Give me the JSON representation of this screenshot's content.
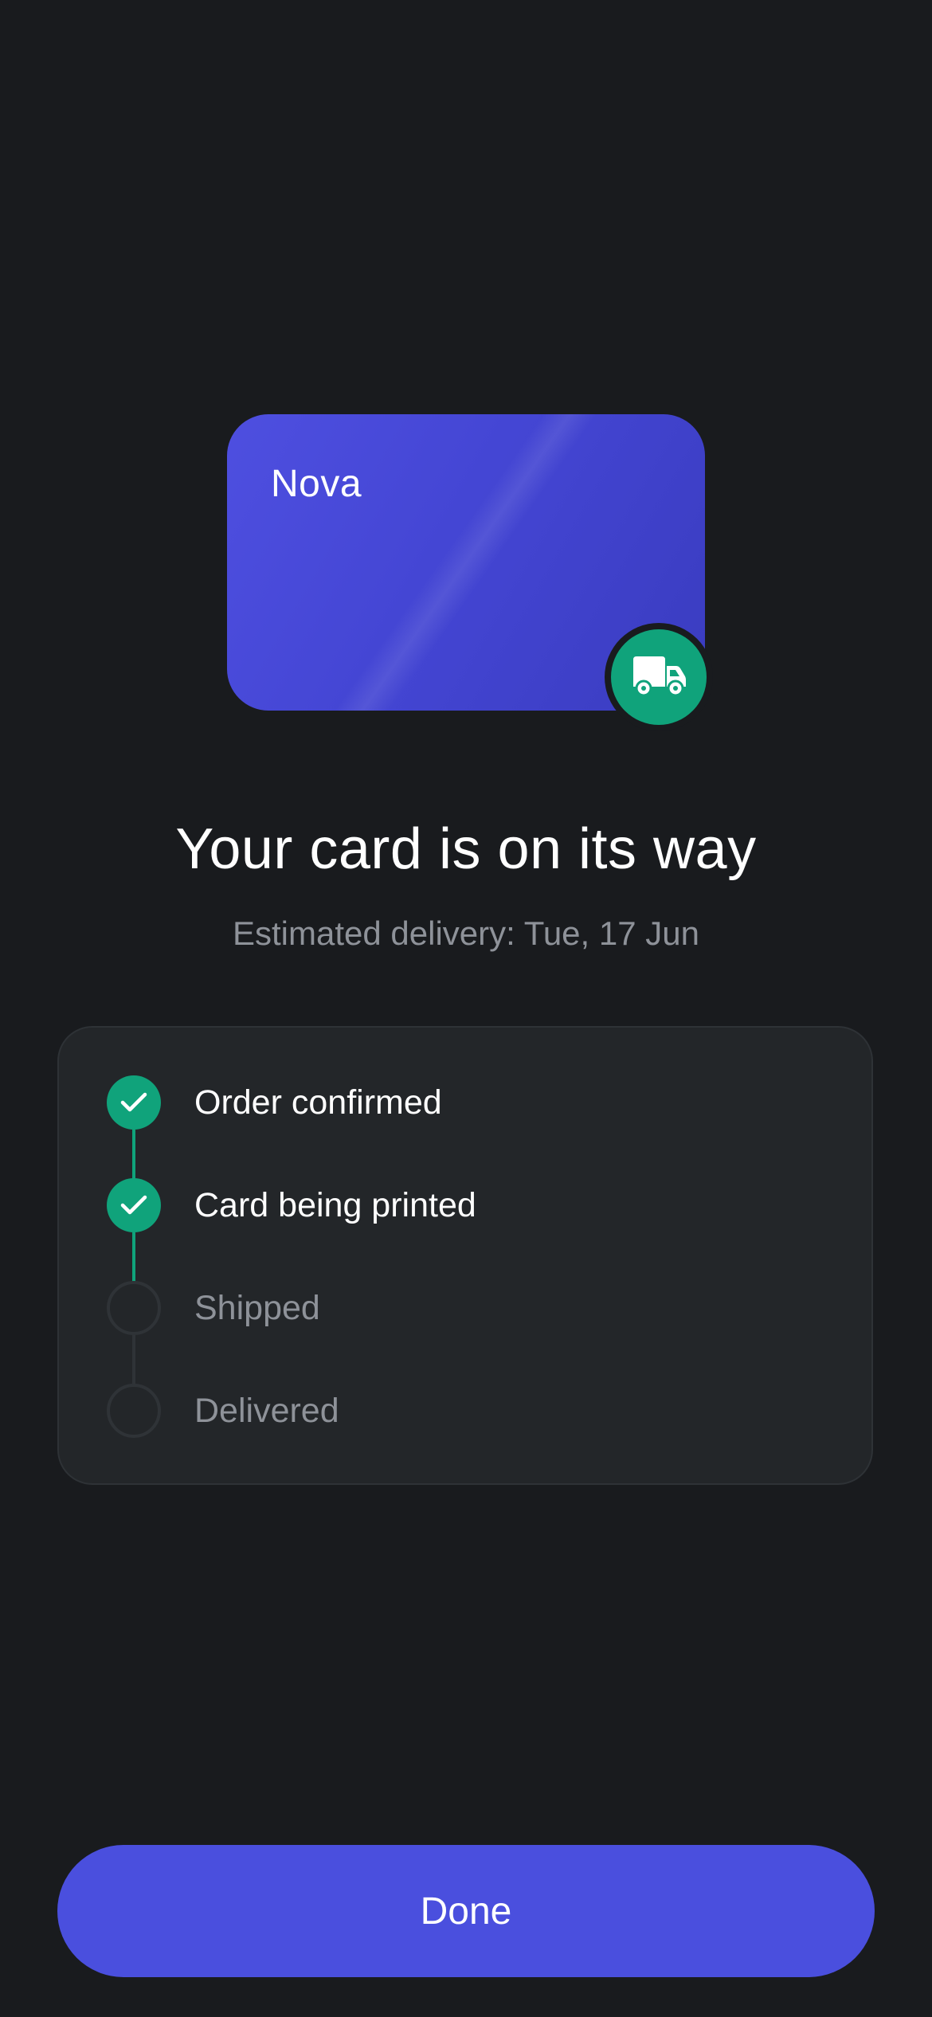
{
  "card": {
    "brand": "Nova",
    "badge_icon": "truck-icon",
    "accent_color": "#4a4fde",
    "badge_color": "#10a37b"
  },
  "header": {
    "title": "Your card is on its way",
    "subtitle": "Estimated delivery: Tue, 17 Jun"
  },
  "timeline": {
    "steps": [
      {
        "label": "Order confirmed",
        "status": "done",
        "icon": "check-icon"
      },
      {
        "label": "Card being printed",
        "status": "done",
        "icon": "check-icon"
      },
      {
        "label": "Shipped",
        "status": "pending",
        "icon": "empty-circle-icon"
      },
      {
        "label": "Delivered",
        "status": "pending",
        "icon": "empty-circle-icon"
      }
    ]
  },
  "actions": {
    "done_label": "Done"
  }
}
